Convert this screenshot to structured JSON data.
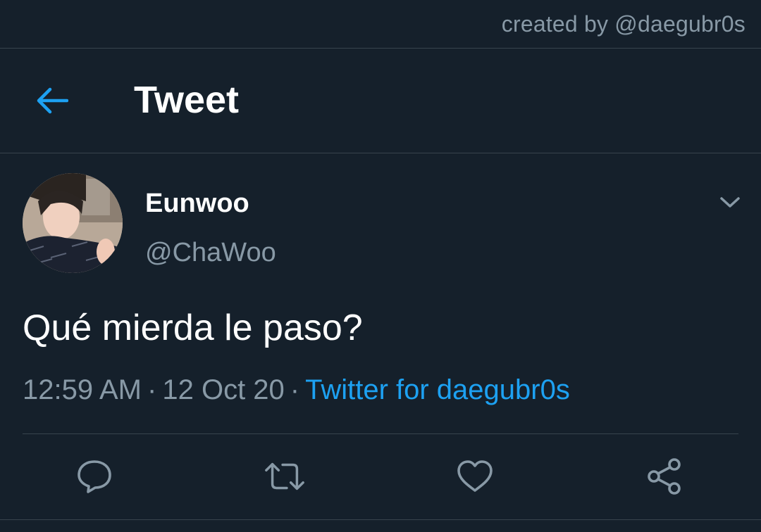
{
  "credit": "created by @daegubr0s",
  "header": {
    "title": "Tweet",
    "back_icon": "arrow-left-icon"
  },
  "tweet": {
    "display_name": "Eunwoo",
    "handle": "@ChaWoo",
    "text": "Qué mierda le paso?",
    "time": "12:59 AM",
    "separator": "·",
    "date": "12 Oct 20",
    "source": "Twitter for daegubr0s"
  },
  "actions": [
    {
      "icon": "reply-icon"
    },
    {
      "icon": "retweet-icon"
    },
    {
      "icon": "like-icon"
    },
    {
      "icon": "share-icon"
    }
  ],
  "colors": {
    "background": "#15202b",
    "border": "#38444d",
    "accent": "#1da1f2",
    "secondary_text": "#8899a6",
    "primary_text": "#ffffff"
  }
}
